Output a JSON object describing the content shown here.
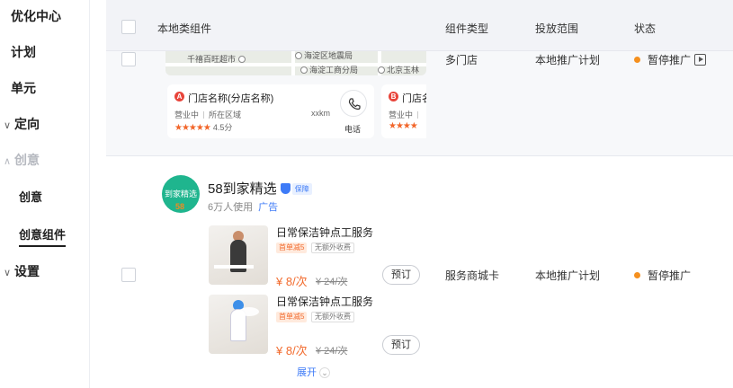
{
  "sidebar": {
    "items": [
      {
        "label": "优化中心"
      },
      {
        "label": "计划"
      },
      {
        "label": "单元"
      },
      {
        "label": "定向",
        "chevron": "chevron-down"
      },
      {
        "label": "创意",
        "chevron": "chevron-up",
        "disabled": true
      },
      {
        "label": "创意"
      },
      {
        "label": "创意组件",
        "active": true
      },
      {
        "label": "设置",
        "chevron": "chevron-down"
      }
    ]
  },
  "table": {
    "headers": {
      "component": "本地类组件",
      "type": "组件类型",
      "scope": "投放范围",
      "status": "状态"
    },
    "rows": [
      {
        "type": "多门店",
        "scope": "本地推广计划",
        "status": "暂停推广",
        "status_color": "#f5901e",
        "map_pois": [
          "千禧百旺超市",
          "海淀区地震局",
          "海淀工商分局",
          "北京玉林"
        ],
        "stores": [
          {
            "marker": "A",
            "name": "门店名称(分店名称)",
            "open": "营业中",
            "area": "所在区域",
            "distance": "xxkm",
            "stars": "★★★★★",
            "rating": "4.5分",
            "phone_label": "电话"
          },
          {
            "marker": "B",
            "name": "门店名",
            "open": "营业中",
            "area": "",
            "stars": "★★★★"
          }
        ]
      },
      {
        "type": "服务商城卡",
        "scope": "本地推广计划",
        "status": "暂停推广",
        "status_color": "#f5901e",
        "ad": {
          "logo_text": "到家精选",
          "logo_sub": "58",
          "brand": "58到家精选",
          "verified_tag": "保障",
          "users": "6万人使用",
          "ad_label": "广告",
          "services": [
            {
              "title": "日常保洁钟点工服务",
              "tag1": "首单减5",
              "tag2": "无额外收费",
              "price": "¥ 8/次",
              "old_price": "¥ 24/次",
              "button": "预订"
            },
            {
              "title": "日常保洁钟点工服务",
              "tag1": "首单减5",
              "tag2": "无额外收费",
              "price": "¥ 8/次",
              "old_price": "¥ 24/次",
              "button": "预订"
            }
          ],
          "expand_label": "展开"
        }
      }
    ]
  }
}
